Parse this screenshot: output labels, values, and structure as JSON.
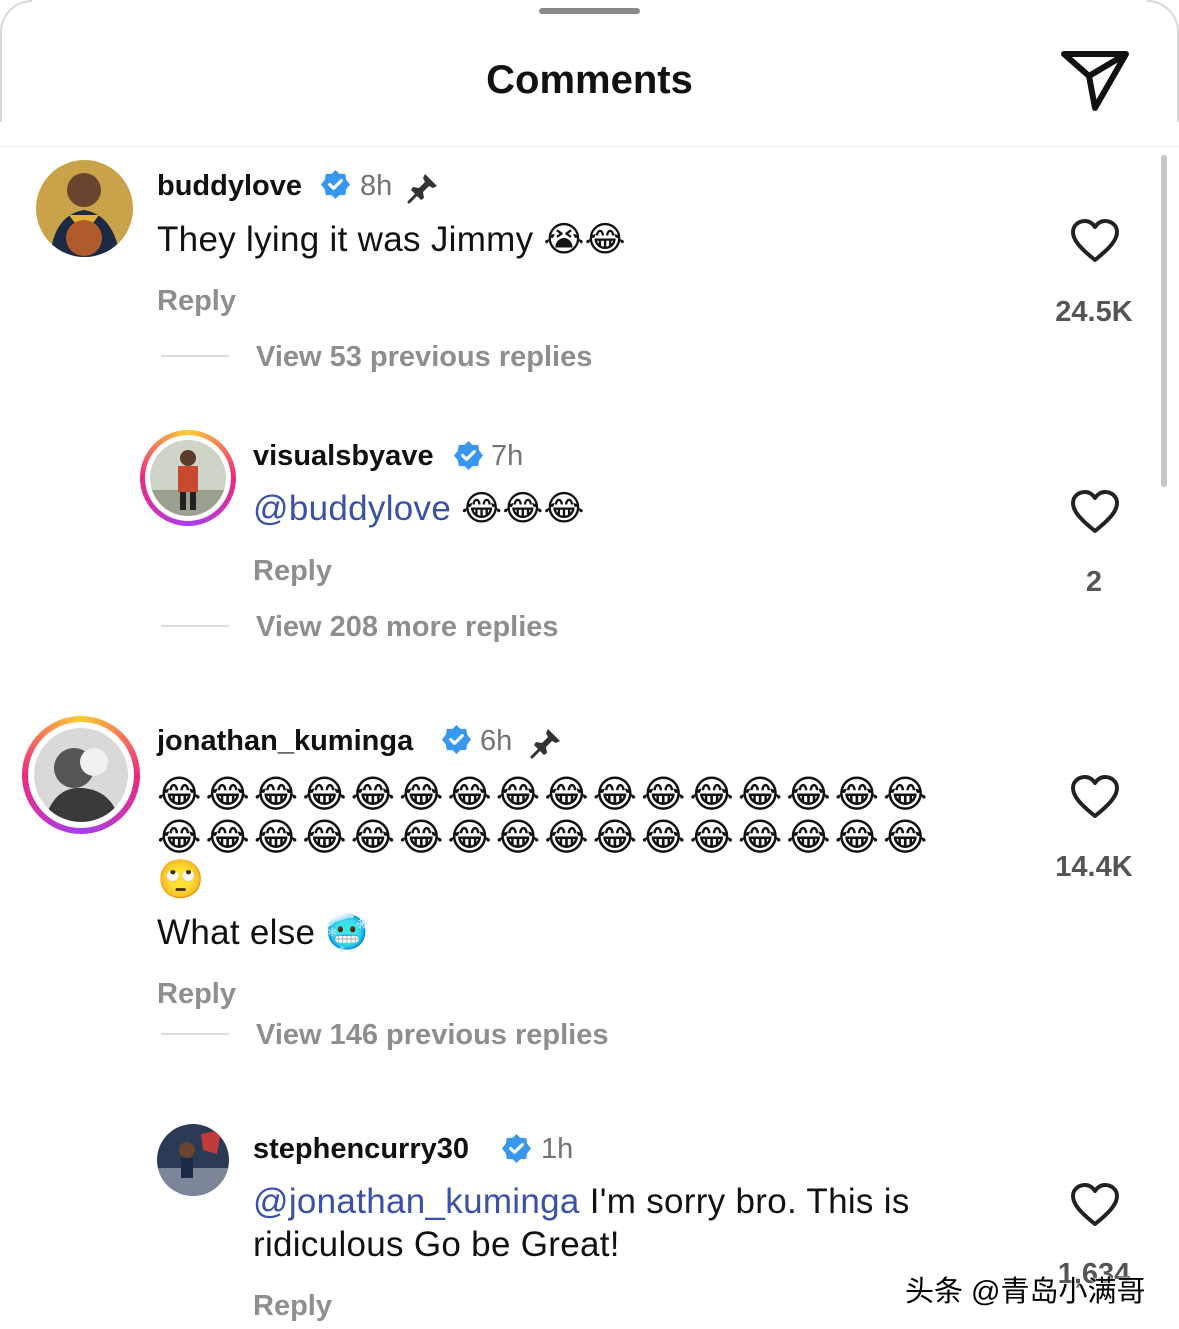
{
  "header": {
    "title": "Comments",
    "share_icon": "send-icon"
  },
  "comments": [
    {
      "username": "buddylove",
      "verified": true,
      "time": "8h",
      "pinned": true,
      "text": "They lying it was Jimmy",
      "emojis": "😭😂",
      "reply_label": "Reply",
      "likes": "24.5K",
      "view_replies": "View 53 previous replies"
    },
    {
      "username": "visualsbyave",
      "verified": true,
      "time": "7h",
      "mention": "@buddylove",
      "emojis": "😂😂😂",
      "reply_label": "Reply",
      "likes": "2",
      "view_replies": "View 208 more replies"
    },
    {
      "username": "jonathan_kuminga",
      "verified": true,
      "time": "6h",
      "pinned": true,
      "emoji_row1": "😂😂😂😂😂😂😂😂😂😂😂😂😂😂😂😂",
      "emoji_row2": "😂😂😂😂😂😂😂😂😂😂😂😂😂😂😂😂",
      "emoji_row3": "🙄",
      "text": "What else",
      "emojis": "🥶",
      "reply_label": "Reply",
      "likes": "14.4K",
      "view_replies": "View 146 previous replies"
    },
    {
      "username": "stephencurry30",
      "verified": true,
      "time": "1h",
      "mention": "@jonathan_kuminga",
      "text_line1": " I'm sorry bro. This is",
      "text_line2": "ridiculous Go be Great!",
      "reply_label": "Reply",
      "likes": "1,634"
    }
  ],
  "watermark": "头条 @青岛小满哥",
  "colors": {
    "mention": "#3b50a8",
    "verified": "#3897f0",
    "muted": "#8e8e8e"
  }
}
